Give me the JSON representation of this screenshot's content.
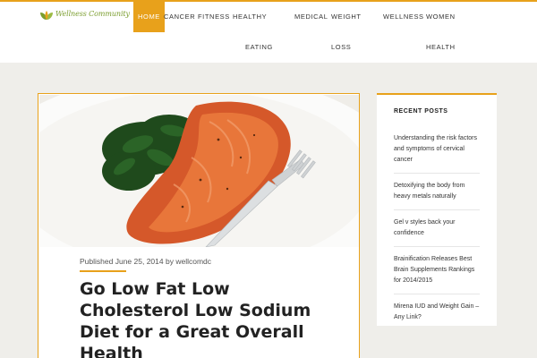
{
  "colors": {
    "accent": "#e8a11b",
    "page_background": "#efeeea",
    "logo_green": "#7b9e2f",
    "title_text": "#222222"
  },
  "header": {
    "logo_text": "Wellness Community",
    "logo_icon": "leaf-icon",
    "nav": [
      {
        "label": "HOME",
        "active": true
      },
      {
        "label": "CANCER",
        "active": false
      },
      {
        "label": "FITNESS",
        "active": false
      },
      {
        "label_line1": "HEALTHY",
        "label_line2": "EATING",
        "active": false
      },
      {
        "label": "MEDICAL",
        "active": false
      },
      {
        "label_line1": "WEIGHT",
        "label_line2": "LOSS",
        "active": false
      },
      {
        "label": "WELLNESS",
        "active": false
      },
      {
        "label_line1": "WOMEN",
        "label_line2": "HEALTH",
        "active": false
      }
    ]
  },
  "article": {
    "image_subject": "salmon-with-spinach-and-fork",
    "meta_prefix": "Published",
    "date": "June 25, 2014",
    "meta_by": "by",
    "author": "wellcomdc",
    "title": "Go Low Fat Low Cholesterol Low Sodium Diet for a Great Overall Health"
  },
  "sidebar": {
    "title": "RECENT POSTS",
    "posts": [
      "Understanding the risk factors and symptoms of cervical cancer",
      "Detoxifying the body from heavy metals naturally",
      "Gel v styles back your confidence",
      "Brainification Releases Best Brain Supplements Rankings for 2014/2015",
      "Mirena IUD and Weight Gain – Any Link?"
    ]
  }
}
